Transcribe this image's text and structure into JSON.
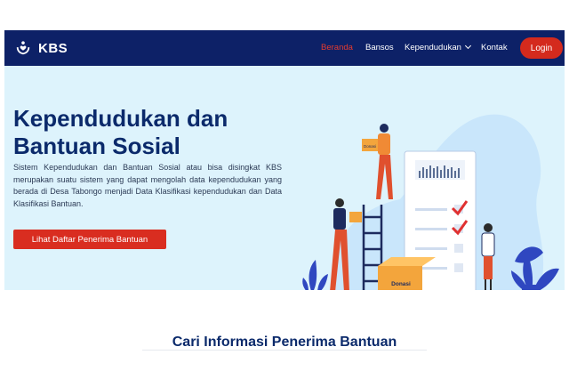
{
  "brand": {
    "name": "KBS",
    "icon": "hands-heart-icon"
  },
  "nav": {
    "items": [
      {
        "label": "Beranda",
        "active": true
      },
      {
        "label": "Bansos",
        "active": false
      },
      {
        "label": "Kependudukan",
        "active": false,
        "has_dropdown": true
      },
      {
        "label": "Kontak",
        "active": false
      }
    ],
    "login_label": "Login"
  },
  "hero": {
    "title_line1": "Kependudukan dan",
    "title_line2": "Bantuan Sosial",
    "description": "Sistem Kependudukan dan Bantuan Sosial atau bisa disingkat KBS merupakan suatu sistem yang dapat mengolah data kependudukan yang berada di Desa Tabongo menjadi Data Klasifikasi kependudukan dan Data Klasifikasi Bantuan.",
    "button_label": "Lihat Daftar Penerima Bantuan",
    "illustration": {
      "box_label": "Donasi",
      "box_label_small": "Donasi"
    }
  },
  "section": {
    "title": "Cari Informasi Penerima Bantuan"
  },
  "colors": {
    "navbar": "#0d2167",
    "accent_red": "#d92d20",
    "hero_bg": "#ddf3fc",
    "title_blue": "#0b2a6b"
  }
}
